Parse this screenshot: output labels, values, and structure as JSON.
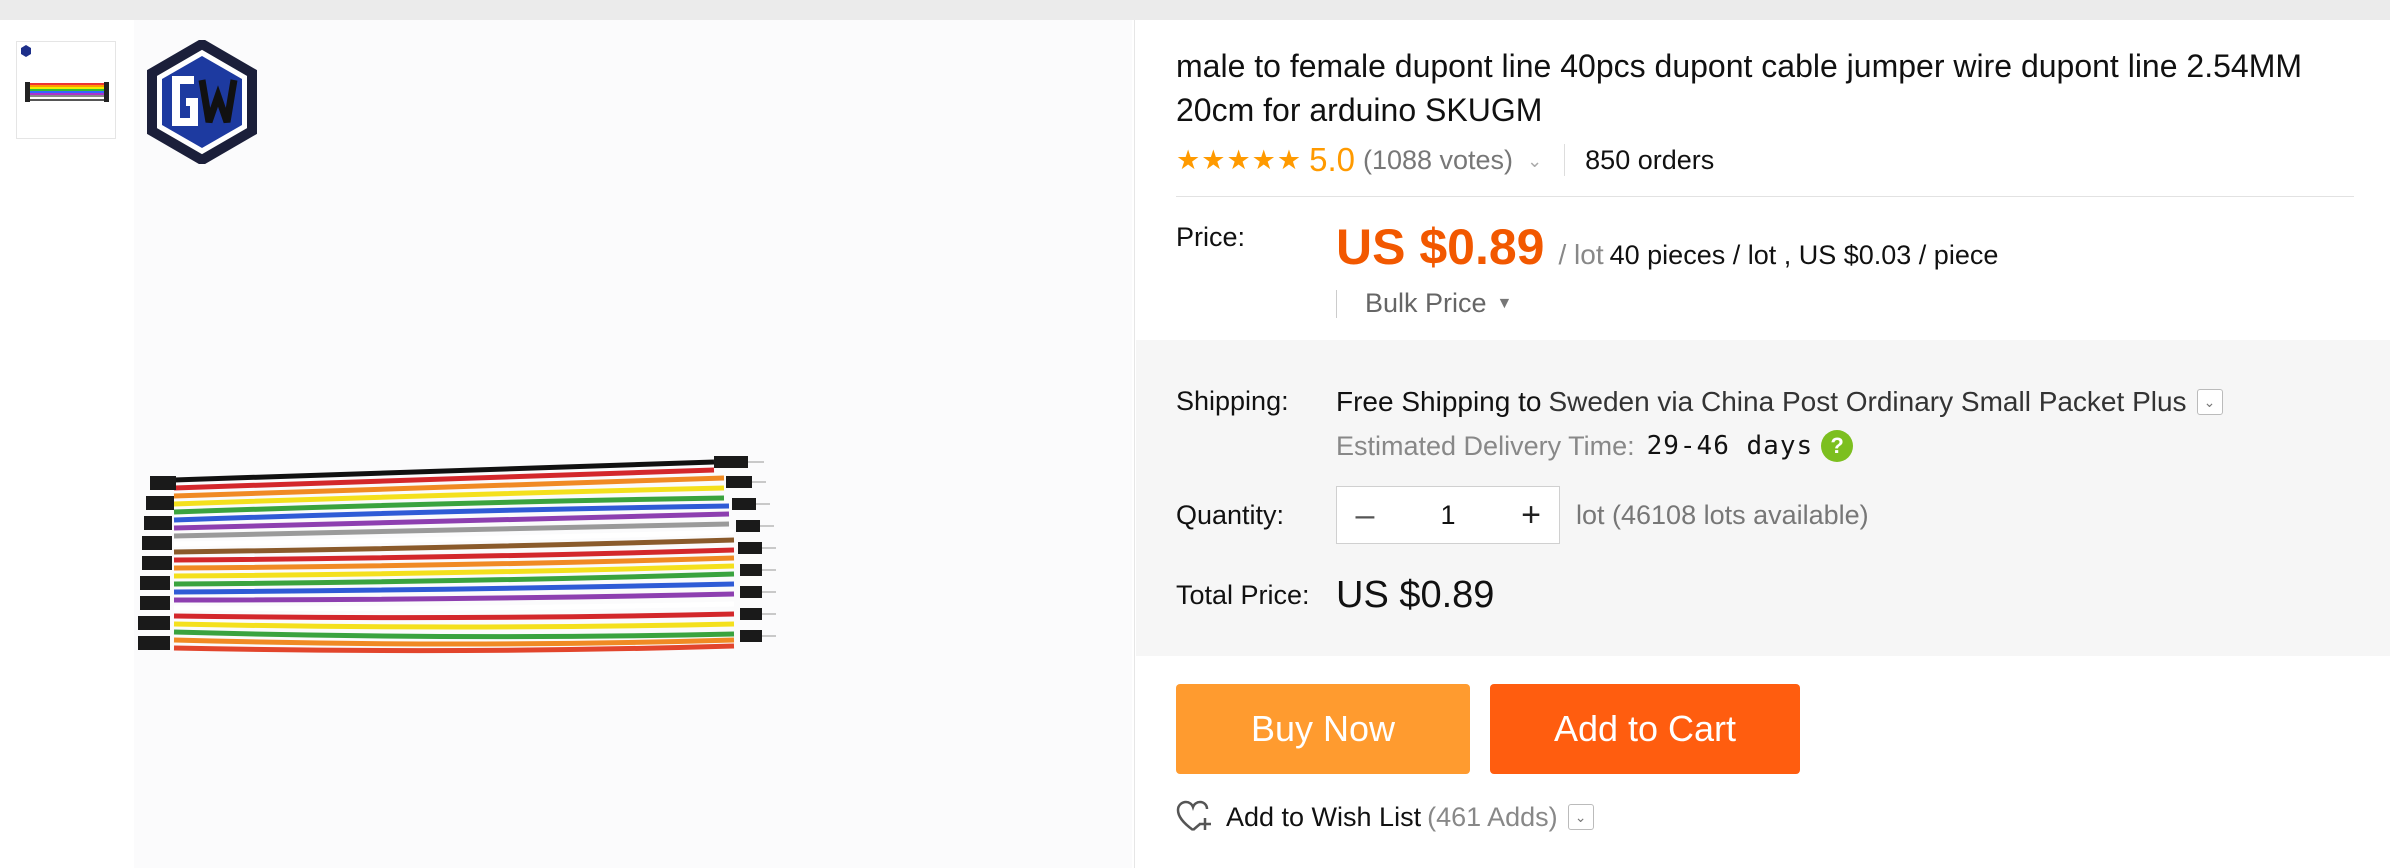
{
  "product": {
    "title": "male to female dupont line 40pcs dupont cable jumper wire dupont line 2.54MM 20cm for arduino SKUGM",
    "rating_value": "5.0",
    "votes": "(1088 votes)",
    "orders": "850 orders",
    "star_count": 5
  },
  "price": {
    "label": "Price:",
    "amount": "US $0.89",
    "per_lot": "/ lot",
    "pieces_info": "40 pieces / lot , US $0.03 / piece",
    "bulk_label": "Bulk Price"
  },
  "shipping": {
    "label": "Shipping:",
    "free": "Free Shipping to",
    "destination": "Sweden via China Post Ordinary Small Packet Plus",
    "eta_label": "Estimated Delivery Time:",
    "eta_days": "29-46 days"
  },
  "quantity": {
    "label": "Quantity:",
    "value": "1",
    "available": "lot (46108 lots available)"
  },
  "total": {
    "label": "Total Price:",
    "amount": "US $0.89"
  },
  "actions": {
    "buy_now": "Buy Now",
    "add_to_cart": "Add to Cart",
    "wish_list": "Add to Wish List",
    "wish_count": "(461 Adds)"
  },
  "colors": {
    "price": "#f25800",
    "star": "#ff9a00",
    "buy_now": "#ff9b2f",
    "add_to_cart": "#ff5d0f",
    "help_badge": "#7cbf1f"
  },
  "icons": {
    "star": "star-icon",
    "help": "question-icon",
    "heart": "heart-plus-icon",
    "minus": "minus-icon",
    "plus": "plus-icon",
    "dropdown": "chevron-down-icon"
  }
}
